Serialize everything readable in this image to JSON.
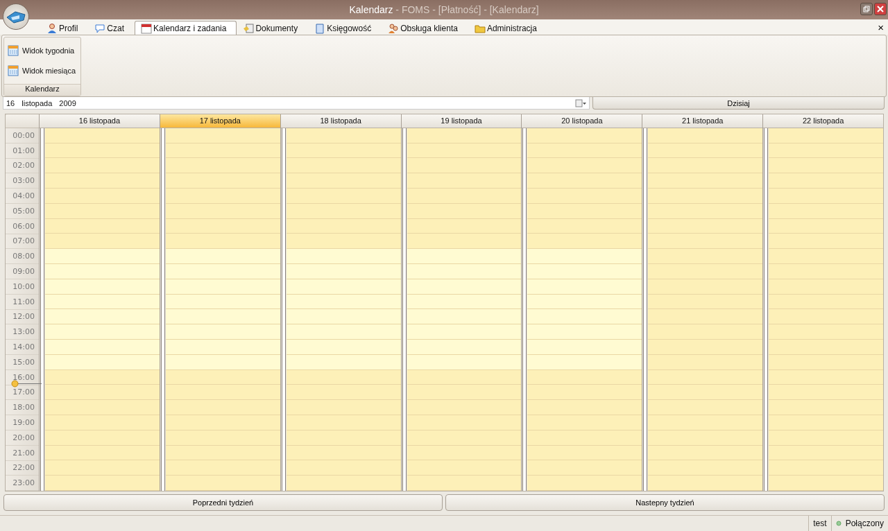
{
  "window": {
    "title_main": "Kalendarz",
    "title_rest": "- FOMS - [Płatność] - [Kalendarz]"
  },
  "tabs": [
    {
      "label": "Profil",
      "selected": false
    },
    {
      "label": "Czat",
      "selected": false
    },
    {
      "label": "Kalendarz i zadania",
      "selected": true
    },
    {
      "label": "Dokumenty",
      "selected": false
    },
    {
      "label": "Księgowość",
      "selected": false
    },
    {
      "label": "Obsługa klienta",
      "selected": false
    },
    {
      "label": "Administracja",
      "selected": false
    }
  ],
  "close_glyph": "×",
  "ribbon": {
    "group_label": "Kalendarz",
    "buttons": [
      {
        "label": "Widok tygodnia"
      },
      {
        "label": "Widok miesiąca"
      }
    ]
  },
  "date_field": {
    "day": "16",
    "month": "listopada",
    "year": "2009"
  },
  "today_button": "Dzisiaj",
  "days": [
    {
      "label": "16 listopada",
      "selected": false,
      "weekend": false
    },
    {
      "label": "17 listopada",
      "selected": true,
      "weekend": false
    },
    {
      "label": "18 listopada",
      "selected": false,
      "weekend": false
    },
    {
      "label": "19 listopada",
      "selected": false,
      "weekend": false
    },
    {
      "label": "20 listopada",
      "selected": false,
      "weekend": false
    },
    {
      "label": "21 listopada",
      "selected": false,
      "weekend": true
    },
    {
      "label": "22 listopada",
      "selected": false,
      "weekend": true
    }
  ],
  "hours": [
    {
      "label": "00:00",
      "work": false,
      "now": false
    },
    {
      "label": "01:00",
      "work": false,
      "now": false
    },
    {
      "label": "02:00",
      "work": false,
      "now": false
    },
    {
      "label": "03:00",
      "work": false,
      "now": false
    },
    {
      "label": "04:00",
      "work": false,
      "now": false
    },
    {
      "label": "05:00",
      "work": false,
      "now": false
    },
    {
      "label": "06:00",
      "work": false,
      "now": false
    },
    {
      "label": "07:00",
      "work": false,
      "now": false
    },
    {
      "label": "08:00",
      "work": true,
      "now": false
    },
    {
      "label": "09:00",
      "work": true,
      "now": false
    },
    {
      "label": "10:00",
      "work": true,
      "now": false
    },
    {
      "label": "11:00",
      "work": true,
      "now": false
    },
    {
      "label": "12:00",
      "work": true,
      "now": false
    },
    {
      "label": "13:00",
      "work": true,
      "now": false
    },
    {
      "label": "14:00",
      "work": true,
      "now": false
    },
    {
      "label": "15:00",
      "work": true,
      "now": false
    },
    {
      "label": "16:00",
      "work": false,
      "now": true
    },
    {
      "label": "17:00",
      "work": false,
      "now": false
    },
    {
      "label": "18:00",
      "work": false,
      "now": false
    },
    {
      "label": "19:00",
      "work": false,
      "now": false
    },
    {
      "label": "20:00",
      "work": false,
      "now": false
    },
    {
      "label": "21:00",
      "work": false,
      "now": false
    },
    {
      "label": "22:00",
      "work": false,
      "now": false
    },
    {
      "label": "23:00",
      "work": false,
      "now": false
    }
  ],
  "nav_buttons": [
    "Poprzedni tydzień",
    "Nastepny tydzień"
  ],
  "status_bar": {
    "user": "test",
    "connection": "Połączony"
  }
}
